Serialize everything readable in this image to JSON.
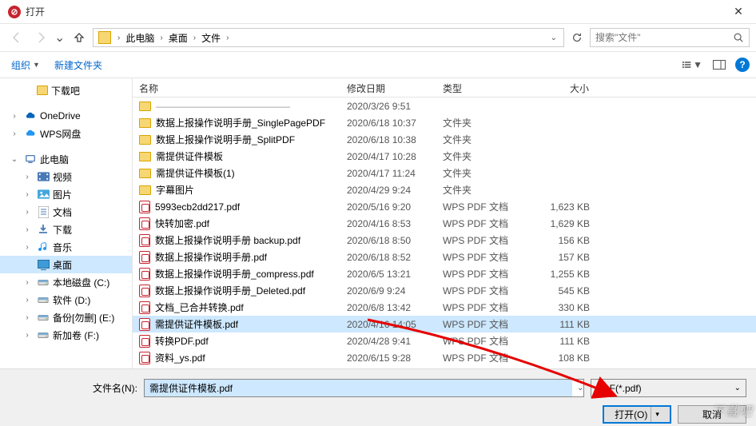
{
  "window": {
    "title": "打开"
  },
  "breadcrumbs": [
    "此电脑",
    "桌面",
    "文件"
  ],
  "search": {
    "placeholder": "搜索\"文件\""
  },
  "toolbar": {
    "organize": "组织",
    "newfolder": "新建文件夹"
  },
  "sidebar": {
    "items": [
      {
        "label": "下载吧",
        "kind": "folder",
        "indent": 26,
        "tw": ""
      },
      {
        "label": "OneDrive",
        "kind": "onedrive",
        "indent": 10,
        "tw": "›"
      },
      {
        "label": "WPS网盘",
        "kind": "wps",
        "indent": 10,
        "tw": "›"
      },
      {
        "label": "此电脑",
        "kind": "pc",
        "indent": 10,
        "tw": "⌄"
      },
      {
        "label": "视频",
        "kind": "video",
        "indent": 26,
        "tw": "›"
      },
      {
        "label": "图片",
        "kind": "image",
        "indent": 26,
        "tw": "›"
      },
      {
        "label": "文档",
        "kind": "doc",
        "indent": 26,
        "tw": "›"
      },
      {
        "label": "下载",
        "kind": "download",
        "indent": 26,
        "tw": "›"
      },
      {
        "label": "音乐",
        "kind": "music",
        "indent": 26,
        "tw": "›"
      },
      {
        "label": "桌面",
        "kind": "desktop",
        "indent": 26,
        "tw": "",
        "sel": true
      },
      {
        "label": "本地磁盘 (C:)",
        "kind": "drive",
        "indent": 26,
        "tw": "›"
      },
      {
        "label": "软件 (D:)",
        "kind": "drive",
        "indent": 26,
        "tw": "›"
      },
      {
        "label": "备份[勿删] (E:)",
        "kind": "drive",
        "indent": 26,
        "tw": "›"
      },
      {
        "label": "新加卷 (F:)",
        "kind": "drive",
        "indent": 26,
        "tw": "›"
      }
    ]
  },
  "columns": {
    "name": "名称",
    "date": "修改日期",
    "type": "类型",
    "size": "大小"
  },
  "files": [
    {
      "name": "——————————————",
      "date": "2020/3/26 9:51",
      "type": "",
      "size": "",
      "icon": "fold",
      "trunc": true
    },
    {
      "name": "数据上报操作说明手册_SinglePagePDF",
      "date": "2020/6/18 10:37",
      "type": "文件夹",
      "size": "",
      "icon": "fold"
    },
    {
      "name": "数据上报操作说明手册_SplitPDF",
      "date": "2020/6/18 10:38",
      "type": "文件夹",
      "size": "",
      "icon": "fold"
    },
    {
      "name": "需提供证件模板",
      "date": "2020/4/17 10:28",
      "type": "文件夹",
      "size": "",
      "icon": "fold"
    },
    {
      "name": "需提供证件模板(1)",
      "date": "2020/4/17 11:24",
      "type": "文件夹",
      "size": "",
      "icon": "fold"
    },
    {
      "name": "字幕图片",
      "date": "2020/4/29 9:24",
      "type": "文件夹",
      "size": "",
      "icon": "fold"
    },
    {
      "name": "5993ecb2dd217.pdf",
      "date": "2020/5/16 9:20",
      "type": "WPS PDF 文档",
      "size": "1,623 KB",
      "icon": "pdf"
    },
    {
      "name": "快转加密.pdf",
      "date": "2020/4/16 8:53",
      "type": "WPS PDF 文档",
      "size": "1,629 KB",
      "icon": "pdf"
    },
    {
      "name": "数据上报操作说明手册 backup.pdf",
      "date": "2020/6/18 8:50",
      "type": "WPS PDF 文档",
      "size": "156 KB",
      "icon": "pdf"
    },
    {
      "name": "数据上报操作说明手册.pdf",
      "date": "2020/6/18 8:52",
      "type": "WPS PDF 文档",
      "size": "157 KB",
      "icon": "pdf"
    },
    {
      "name": "数据上报操作说明手册_compress.pdf",
      "date": "2020/6/5 13:21",
      "type": "WPS PDF 文档",
      "size": "1,255 KB",
      "icon": "pdf"
    },
    {
      "name": "数据上报操作说明手册_Deleted.pdf",
      "date": "2020/6/9 9:24",
      "type": "WPS PDF 文档",
      "size": "545 KB",
      "icon": "pdf"
    },
    {
      "name": "文档_已合并转换.pdf",
      "date": "2020/6/8 13:42",
      "type": "WPS PDF 文档",
      "size": "330 KB",
      "icon": "pdf"
    },
    {
      "name": "需提供证件模板.pdf",
      "date": "2020/4/16 14:05",
      "type": "WPS PDF 文档",
      "size": "111 KB",
      "icon": "pdf",
      "sel": true
    },
    {
      "name": "转换PDF.pdf",
      "date": "2020/4/28 9:41",
      "type": "WPS PDF 文档",
      "size": "111 KB",
      "icon": "pdf"
    },
    {
      "name": "资料_ys.pdf",
      "date": "2020/6/15 9:28",
      "type": "WPS PDF 文档",
      "size": "108 KB",
      "icon": "pdf"
    }
  ],
  "bottom": {
    "filename_label": "文件名(N):",
    "filename_value": "需提供证件模板.pdf",
    "filter": "PDF(*.pdf)",
    "open": "打开(O)",
    "cancel": "取消"
  },
  "watermark": "下载吧"
}
